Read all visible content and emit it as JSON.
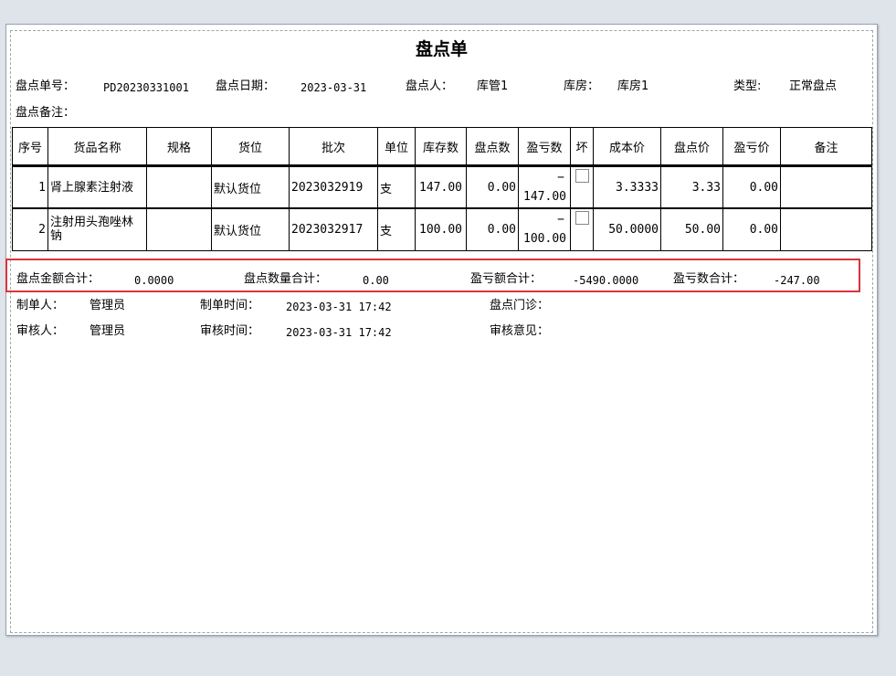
{
  "document": {
    "title": "盘点单",
    "header": {
      "no_label": "盘点单号：",
      "no_value": "PD20230331001",
      "date_label": "盘点日期：",
      "date_value": "2023-03-31",
      "person_label": "盘点人：",
      "person_value": "库管1",
      "warehouse_label": "库房：",
      "warehouse_value": "库房1",
      "type_label": "类型:",
      "type_value": "正常盘点",
      "remark_label": "盘点备注："
    },
    "columns": [
      "序号",
      "货品名称",
      "规格",
      "货位",
      "批次",
      "单位",
      "库存数",
      "盘点数",
      "盈亏数",
      "坏",
      "成本价",
      "盘点价",
      "盈亏价",
      "备注"
    ],
    "rows": [
      {
        "seq": "1",
        "name": "肾上腺素注射液",
        "spec": "",
        "location": "默认货位",
        "batch": "2023032919",
        "unit": "支",
        "stock": "147.00",
        "counted": "0.00",
        "diff_sign": "−",
        "diff": "147.00",
        "cost": "3.3333",
        "count_price": "3.33",
        "diff_price": "0.00",
        "remark": ""
      },
      {
        "seq": "2",
        "name": "注射用头孢唑林钠",
        "spec": "",
        "location": "默认货位",
        "batch": "2023032917",
        "unit": "支",
        "stock": "100.00",
        "counted": "0.00",
        "diff_sign": "−",
        "diff": "100.00",
        "cost": "50.0000",
        "count_price": "50.00",
        "diff_price": "0.00",
        "remark": ""
      }
    ],
    "totals": {
      "amount_label": "盘点金额合计：",
      "amount_value": "0.0000",
      "qty_label": "盘点数量合计：",
      "qty_value": "0.00",
      "loss_amount_label": "盈亏额合计：",
      "loss_amount_value": "-5490.0000",
      "loss_qty_label": "盈亏数合计：",
      "loss_qty_value": "-247.00"
    },
    "footer": {
      "maker_label": "制单人：",
      "maker_value": "管理员",
      "make_time_label": "制单时间：",
      "make_time_value": "2023-03-31 17:42",
      "clinic_label": "盘点门诊：",
      "clinic_value": "",
      "reviewer_label": "审核人：",
      "reviewer_value": "管理员",
      "review_time_label": "审核时间：",
      "review_time_value": "2023-03-31 17:42",
      "opinion_label": "审核意见：",
      "opinion_value": ""
    },
    "colors": {
      "highlight": "#d9343b",
      "background": "#dfe3ea"
    }
  }
}
